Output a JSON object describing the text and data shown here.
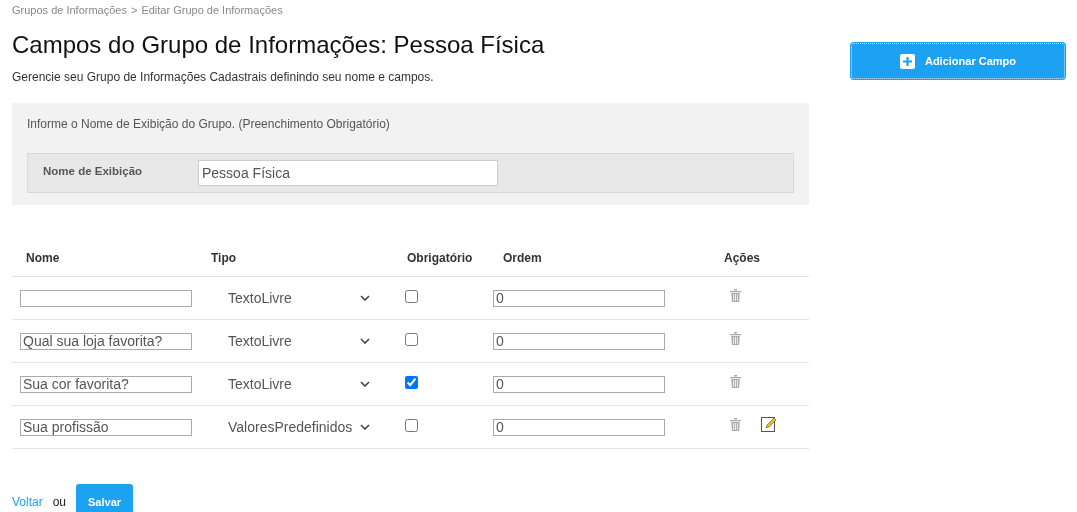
{
  "breadcrumb": {
    "items": [
      "Grupos de Informações",
      "Editar Grupo de Informações"
    ],
    "separator": ">"
  },
  "title": "Campos do Grupo de Informações: Pessoa Física",
  "subtitle": "Gerencie seu Grupo de Informações Cadastrais definindo seu nome e campos.",
  "add_button": {
    "label": "Adicionar Campo"
  },
  "group_panel": {
    "hint": "Informe o Nome de Exibição do Grupo. (Preenchimento Obrigatório)",
    "field_label": "Nome de Exibição",
    "field_value": "Pessoa Física"
  },
  "table": {
    "columns": [
      "Nome",
      "Tipo",
      "Obrigatório",
      "Ordem",
      "Ações"
    ],
    "rows": [
      {
        "name": "",
        "type": "TextoLivre",
        "required": false,
        "order": "0",
        "editable": false
      },
      {
        "name": "Qual sua loja favorita?",
        "type": "TextoLivre",
        "required": false,
        "order": "0",
        "editable": false
      },
      {
        "name": "Sua cor favorita?",
        "type": "TextoLivre",
        "required": true,
        "order": "0",
        "editable": false
      },
      {
        "name": "Sua profissão",
        "type": "ValoresPredefinidos",
        "required": false,
        "order": "0",
        "editable": true
      }
    ]
  },
  "footer": {
    "back_link": "Voltar",
    "or_text": "ou",
    "save_button": "Salvar"
  }
}
